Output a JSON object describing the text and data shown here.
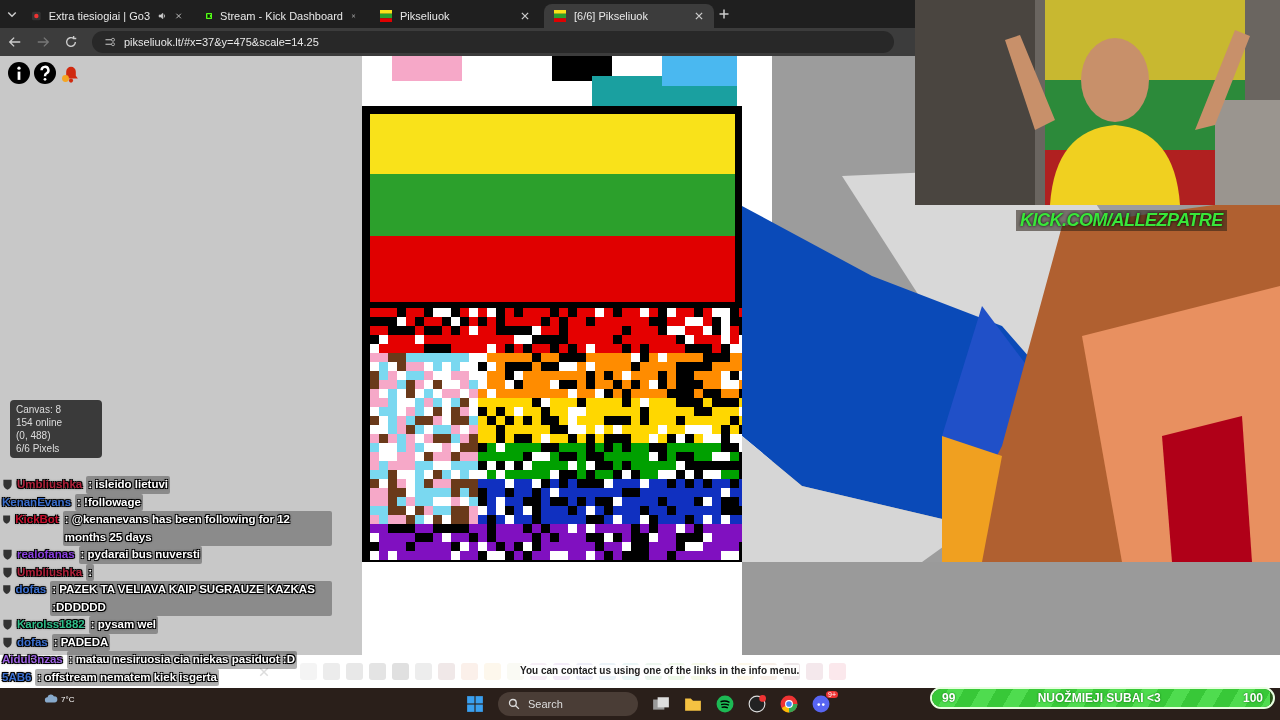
{
  "tabs": [
    {
      "title": "Extra tiesiogiai | Go3",
      "kind": "media",
      "selected": false
    },
    {
      "title": "Stream - Kick Dashboard",
      "kind": "kick",
      "selected": false
    },
    {
      "title": "Pikseliuok",
      "kind": "pixel",
      "selected": false
    },
    {
      "title": "[6/6] Pikseliuok",
      "kind": "pixel",
      "selected": true
    }
  ],
  "address": "pikseliuok.lt/#x=37&y=475&scale=14.25",
  "info_card": [
    "Canvas: 8",
    "154 online",
    "(0, 488)",
    "6/6 Pixels"
  ],
  "chat": [
    {
      "user": "Umbliushka",
      "color": "#b0203a",
      "text": ": isleido lietuvi",
      "badge": true
    },
    {
      "user": "KenanEvans",
      "color": "#3a6fd0",
      "text": ": !followage",
      "badge": false
    },
    {
      "user": "KickBot",
      "color": "#c8102e",
      "text": ": @kenanevans has been following for 12 months 25 days",
      "badge": true
    },
    {
      "user": "realofanas",
      "color": "#8a3fe0",
      "text": ": pydarai bus nuversti",
      "badge": true
    },
    {
      "user": "Umbliushka",
      "color": "#b0203a",
      "text": ":",
      "badge": true
    },
    {
      "user": "dofas",
      "color": "#3a6fd0",
      "text": ": PAZEK TA VELIAVA KAIP SUGRAUZE KAZKAS :DDDDDD",
      "badge": true
    },
    {
      "user": "Karolss1882",
      "color": "#2fbf8a",
      "text": ": pysam wel",
      "badge": true
    },
    {
      "user": "dofas",
      "color": "#3a6fd0",
      "text": ": PADEDA",
      "badge": true
    },
    {
      "user": "Aidul3nzas",
      "color": "#9a5fe0",
      "text": ": matau nesiruosia cia niekas pasiduot :D",
      "badge": false
    },
    {
      "user": "5AB6",
      "color": "#3a6fd0",
      "text": ": offstream nematem kiek isgerta",
      "badge": false
    }
  ],
  "notice": "You can contact us using one of the links in the info menu.",
  "palette": [
    {
      "color": "#f4f4f4"
    },
    {
      "color": "#ececec"
    },
    {
      "color": "#e8e8e8"
    },
    {
      "color": "#e4e4e4"
    },
    {
      "color": "#e0e0e0"
    },
    {
      "color": "#ededed"
    },
    {
      "color": "#f0e8e8"
    },
    {
      "color": "#fbf0ea"
    },
    {
      "color": "#fdf7ec"
    },
    {
      "color": "#fafaf4"
    },
    {
      "color": "#f6eef6"
    },
    {
      "color": "#f3ebf8"
    },
    {
      "color": "#eeeef8"
    },
    {
      "color": "#ebf3f8"
    },
    {
      "color": "#eaf6f6"
    },
    {
      "color": "#ecf6ee"
    },
    {
      "color": "#eef8e8"
    },
    {
      "color": "#f6fae8"
    },
    {
      "color": "#fffff0"
    },
    {
      "color": "#fdf8ea"
    },
    {
      "color": "#f8efe8"
    },
    {
      "color": "#efe8ea"
    },
    {
      "color": "#f4e8ec"
    },
    {
      "color": "#fbe8ec"
    }
  ],
  "stream_url": "KICK.COM/ALLEZPATRE",
  "goal": {
    "start": "99",
    "label": "NUOŽMIEJI SUBAI <3",
    "end": "100",
    "level": 0.99
  },
  "weather": "7°C",
  "taskbar": {
    "search_placeholder": "Search",
    "badge": "9+"
  }
}
